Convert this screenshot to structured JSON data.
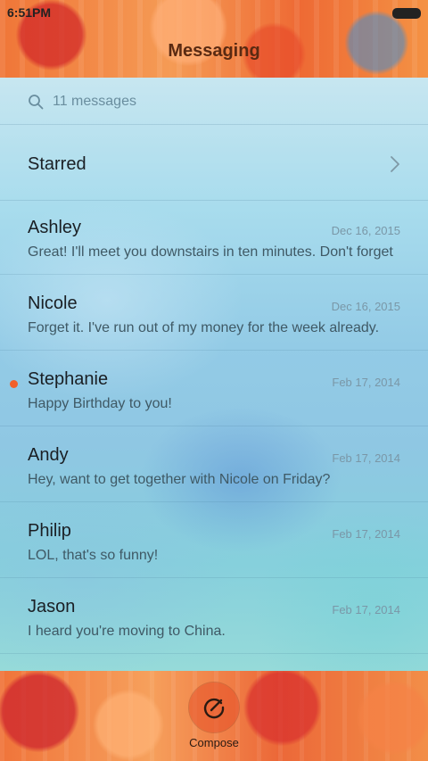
{
  "status_bar": {
    "time": "6:51PM"
  },
  "header": {
    "title": "Messaging"
  },
  "search": {
    "text": "11 messages"
  },
  "starred": {
    "label": "Starred"
  },
  "messages": [
    {
      "name": "Ashley",
      "date": "Dec 16, 2015",
      "preview": "Great! I'll meet you downstairs in ten minutes. Don't forget",
      "unread": false
    },
    {
      "name": "Nicole",
      "date": "Dec 16, 2015",
      "preview": "Forget it. I've run out of my money for the week already.",
      "unread": false
    },
    {
      "name": "Stephanie",
      "date": "Feb 17, 2014",
      "preview": "Happy Birthday to you!",
      "unread": true
    },
    {
      "name": "Andy",
      "date": "Feb 17, 2014",
      "preview": "Hey, want to get together with Nicole on Friday?",
      "unread": false
    },
    {
      "name": "Philip",
      "date": "Feb 17, 2014",
      "preview": "LOL, that's so funny!",
      "unread": false
    },
    {
      "name": "Jason",
      "date": "Feb 17, 2014",
      "preview": "I heard you're moving to China.",
      "unread": false
    }
  ],
  "compose": {
    "label": "Compose"
  },
  "colors": {
    "accent": "#f2602a",
    "unread_dot": "#f2602a"
  },
  "icons": {
    "search": "search-icon",
    "chevron": "chevron-right-icon",
    "compose": "compose-icon",
    "battery": "battery-icon"
  }
}
